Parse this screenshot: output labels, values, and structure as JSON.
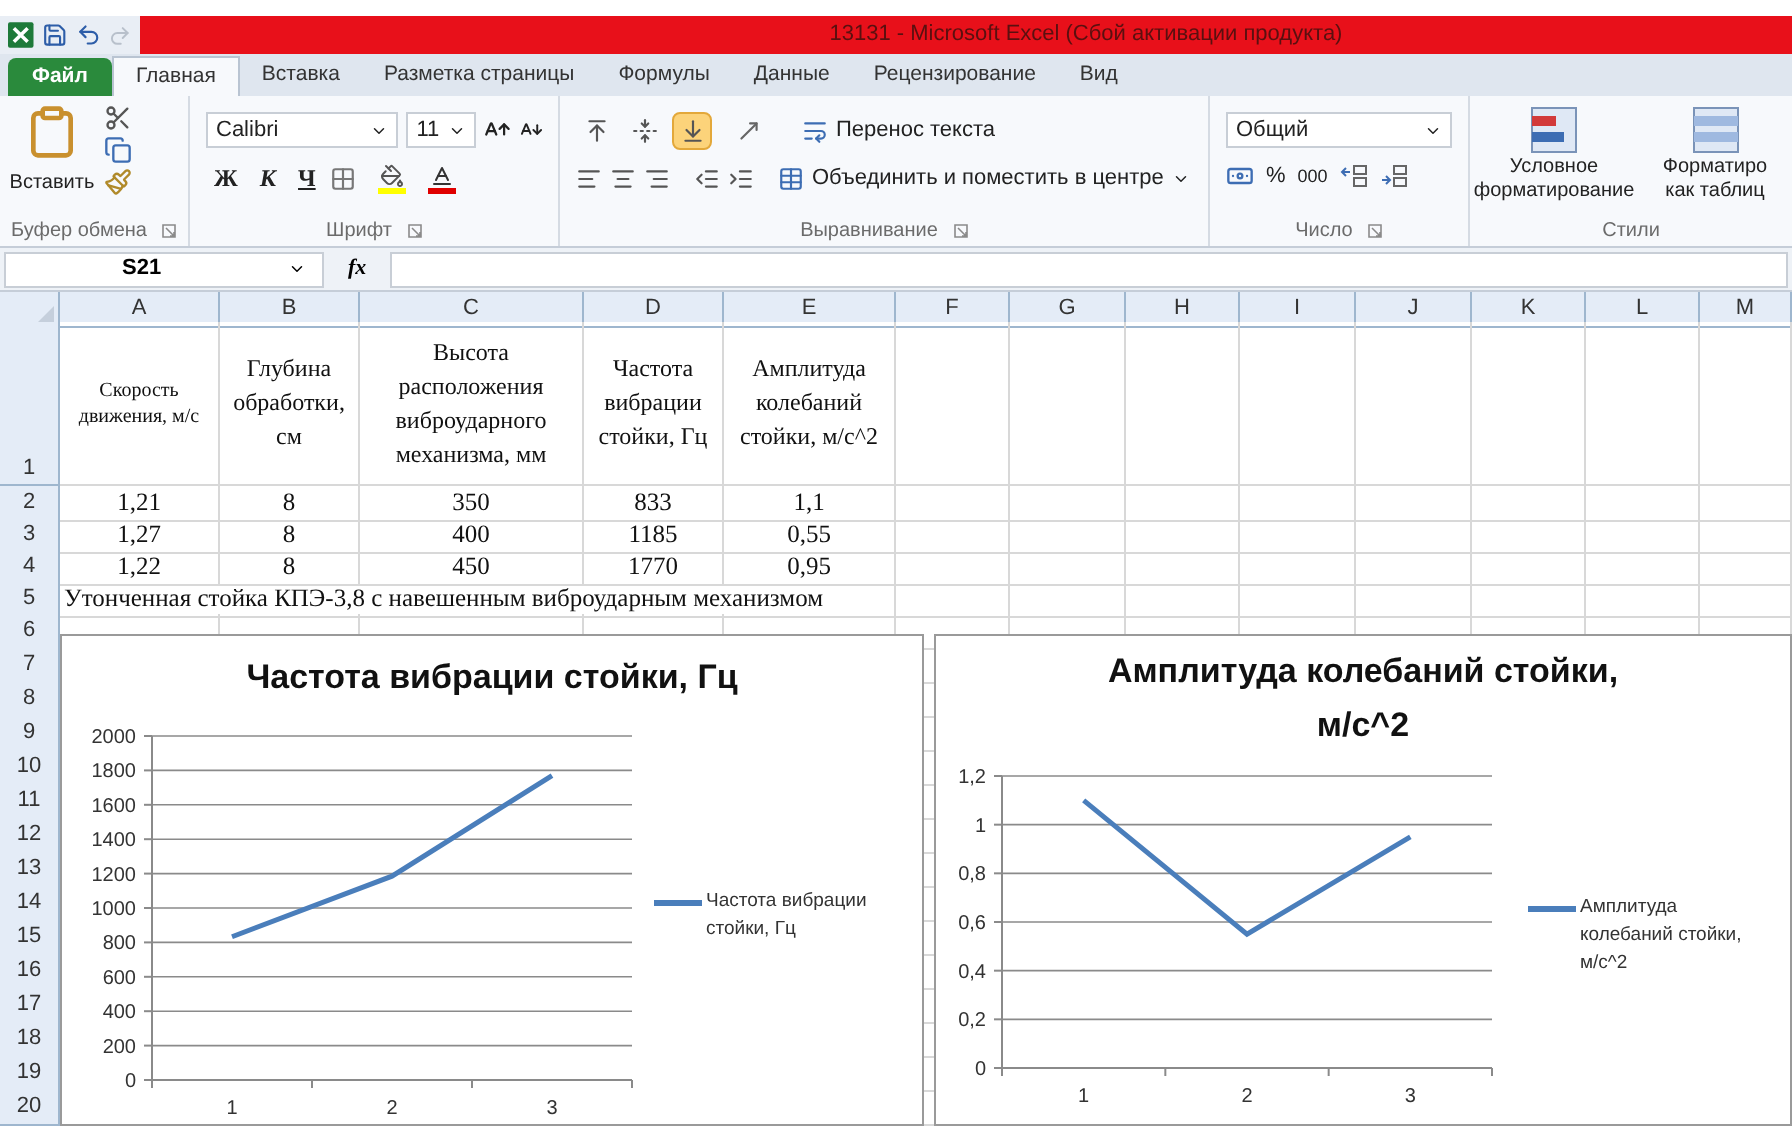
{
  "window": {
    "title": "13131  -  Microsoft Excel (Сбой активации продукта)"
  },
  "tabs": [
    {
      "label": "Файл",
      "kind": "file",
      "selected": false
    },
    {
      "label": "Главная",
      "kind": "tab",
      "selected": true
    },
    {
      "label": "Вставка",
      "kind": "tab",
      "selected": false
    },
    {
      "label": "Разметка страницы",
      "kind": "tab",
      "selected": false
    },
    {
      "label": "Формулы",
      "kind": "tab",
      "selected": false
    },
    {
      "label": "Данные",
      "kind": "tab",
      "selected": false
    },
    {
      "label": "Рецензирование",
      "kind": "tab",
      "selected": false
    },
    {
      "label": "Вид",
      "kind": "tab",
      "selected": false
    }
  ],
  "ribbon": {
    "clipboard": {
      "paste": "Вставить",
      "group": "Буфер обмена"
    },
    "font": {
      "name": "Calibri",
      "size": "11",
      "bold": "Ж",
      "italic": "К",
      "underline": "Ч",
      "group": "Шрифт"
    },
    "alignment": {
      "valign": [
        {
          "selected": false
        },
        {
          "selected": false
        },
        {
          "selected": true
        }
      ],
      "wrap": "Перенос текста",
      "merge": "Объединить и поместить в центре",
      "group": "Выравнивание"
    },
    "number": {
      "format": "Общий",
      "percent": "%",
      "thousands": "000",
      "group": "Число"
    },
    "styles": {
      "buttons": [
        {
          "lines": [
            "Условное",
            "форматирование"
          ]
        },
        {
          "lines": [
            "Форматиро",
            "как таблиц"
          ]
        }
      ],
      "group": "Стили"
    }
  },
  "formula_bar": {
    "name_box": "S21",
    "fx": "fx"
  },
  "columns": [
    "A",
    "B",
    "C",
    "D",
    "E",
    "F",
    "G",
    "H",
    "I",
    "J",
    "K",
    "L",
    "M"
  ],
  "rows": [
    {
      "number": "1",
      "cells": [
        "Скорость движения, м/с",
        "Глубина обработки, см",
        "Высота расположения виброударного механизма, мм",
        "Частота вибрации стойки, Гц",
        "Амплитуда колебаний стойки, м/с^2"
      ]
    },
    {
      "number": "2",
      "cells": [
        "1,21",
        "8",
        "350",
        "833",
        "1,1"
      ]
    },
    {
      "number": "3",
      "cells": [
        "1,27",
        "8",
        "400",
        "1185",
        "0,55"
      ]
    },
    {
      "number": "4",
      "cells": [
        "1,22",
        "8",
        "450",
        "1770",
        "0,95"
      ]
    },
    {
      "number": "5",
      "cells": [
        "Утонченная стойка КПЭ-3,8 с навешенным виброударным механизмом"
      ]
    },
    {
      "number": "6"
    },
    {
      "number": "7"
    },
    {
      "number": "8"
    },
    {
      "number": "9"
    },
    {
      "number": "10"
    },
    {
      "number": "11"
    },
    {
      "number": "12"
    },
    {
      "number": "13"
    },
    {
      "number": "14"
    },
    {
      "number": "15"
    },
    {
      "number": "16"
    },
    {
      "number": "17"
    },
    {
      "number": "18"
    },
    {
      "number": "19"
    },
    {
      "number": "20"
    }
  ],
  "charts": [
    {
      "chart_data": {
        "type": "line",
        "title": "Частота вибрации стойки, Гц",
        "categories": [
          "1",
          "2",
          "3"
        ],
        "series": [
          {
            "name": "Частота вибрации стойки, Гц",
            "color": "#4a7ebb",
            "values": [
              833,
              1185,
              1770
            ]
          }
        ],
        "ylim": [
          0,
          2000
        ],
        "yticks": [
          0,
          200,
          400,
          600,
          800,
          1000,
          1200,
          1400,
          1600,
          1800,
          2000
        ],
        "grid": true
      }
    },
    {
      "chart_data": {
        "type": "line",
        "title": "Амплитуда колебаний стойки, м/с^2",
        "categories": [
          "1",
          "2",
          "3"
        ],
        "series": [
          {
            "name": "Амплитуда колебаний стойки, м/с^2",
            "color": "#4a7ebb",
            "values": [
              1.1,
              0.55,
              0.95
            ]
          }
        ],
        "ylim": [
          0,
          1.2
        ],
        "yticks": [
          {
            "value": 0,
            "label": "0"
          },
          {
            "value": 0.2,
            "label": "0,2"
          },
          {
            "value": 0.4,
            "label": "0,4"
          },
          {
            "value": 0.6,
            "label": "0,6"
          },
          {
            "value": 0.8,
            "label": "0,8"
          },
          {
            "value": 1,
            "label": "1"
          },
          {
            "value": 1.2,
            "label": "1,2"
          }
        ],
        "grid": true
      }
    }
  ]
}
